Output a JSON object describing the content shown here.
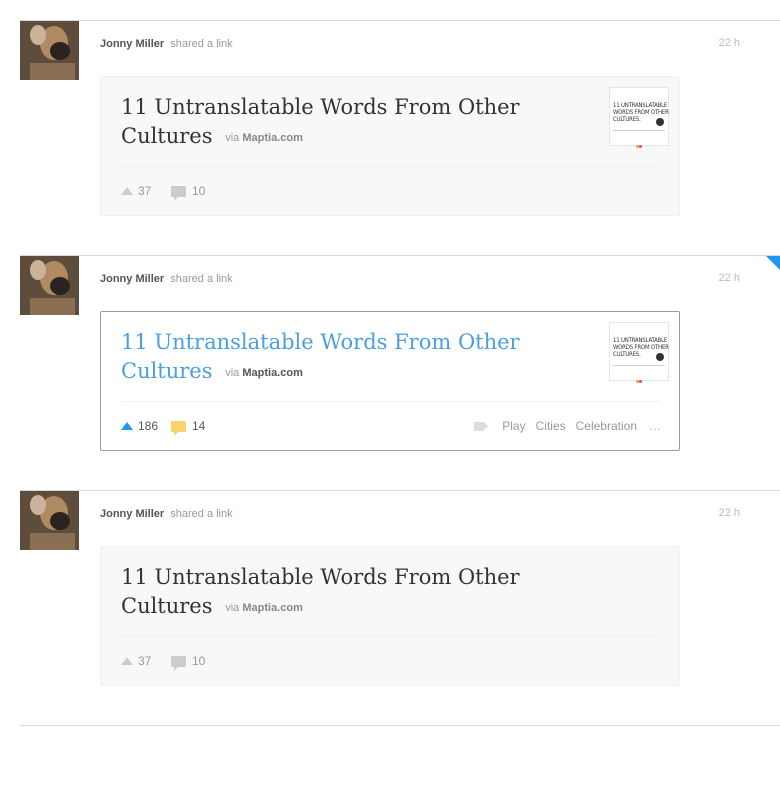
{
  "feed": {
    "items": [
      {
        "author": "Jonny Miller",
        "action": "shared a link",
        "time": "22 h",
        "title": "11 Untranslatable Words From Other Cultures",
        "via_label": "via",
        "source": "Maptia.com",
        "upvotes": "37",
        "comments": "10",
        "state": "default"
      },
      {
        "author": "Jonny Miller",
        "action": "shared a link",
        "time": "22 h",
        "title": "11 Untranslatable Words From Other Cultures",
        "via_label": "via",
        "source": "Maptia.com",
        "upvotes": "186",
        "comments": "14",
        "tags": [
          "Play",
          "Cities",
          "Celebration"
        ],
        "tags_more": "…",
        "state": "hover"
      },
      {
        "author": "Jonny Miller",
        "action": "shared a link",
        "time": "22 h",
        "title": "11 Untranslatable Words From Other Cultures",
        "via_label": "via",
        "source": "Maptia.com",
        "upvotes": "37",
        "comments": "10",
        "state": "default"
      }
    ]
  },
  "thumbnail": {
    "lines": [
      "11 UNTRANSLATABLE",
      "WORDS FROM OTHER",
      "CULTURES."
    ],
    "icon": "globe-icon"
  },
  "icons": {
    "upvote": "triangle-up-icon",
    "comment": "speech-bubble-icon",
    "tag": "tag-icon",
    "avatar": "user-photo"
  },
  "colors": {
    "accent_blue": "#2196f3",
    "link_blue": "#4a9fe0",
    "comment_yellow": "#f9d26b",
    "card_bg": "#f8f8f8",
    "divider": "#d9d9d9"
  }
}
